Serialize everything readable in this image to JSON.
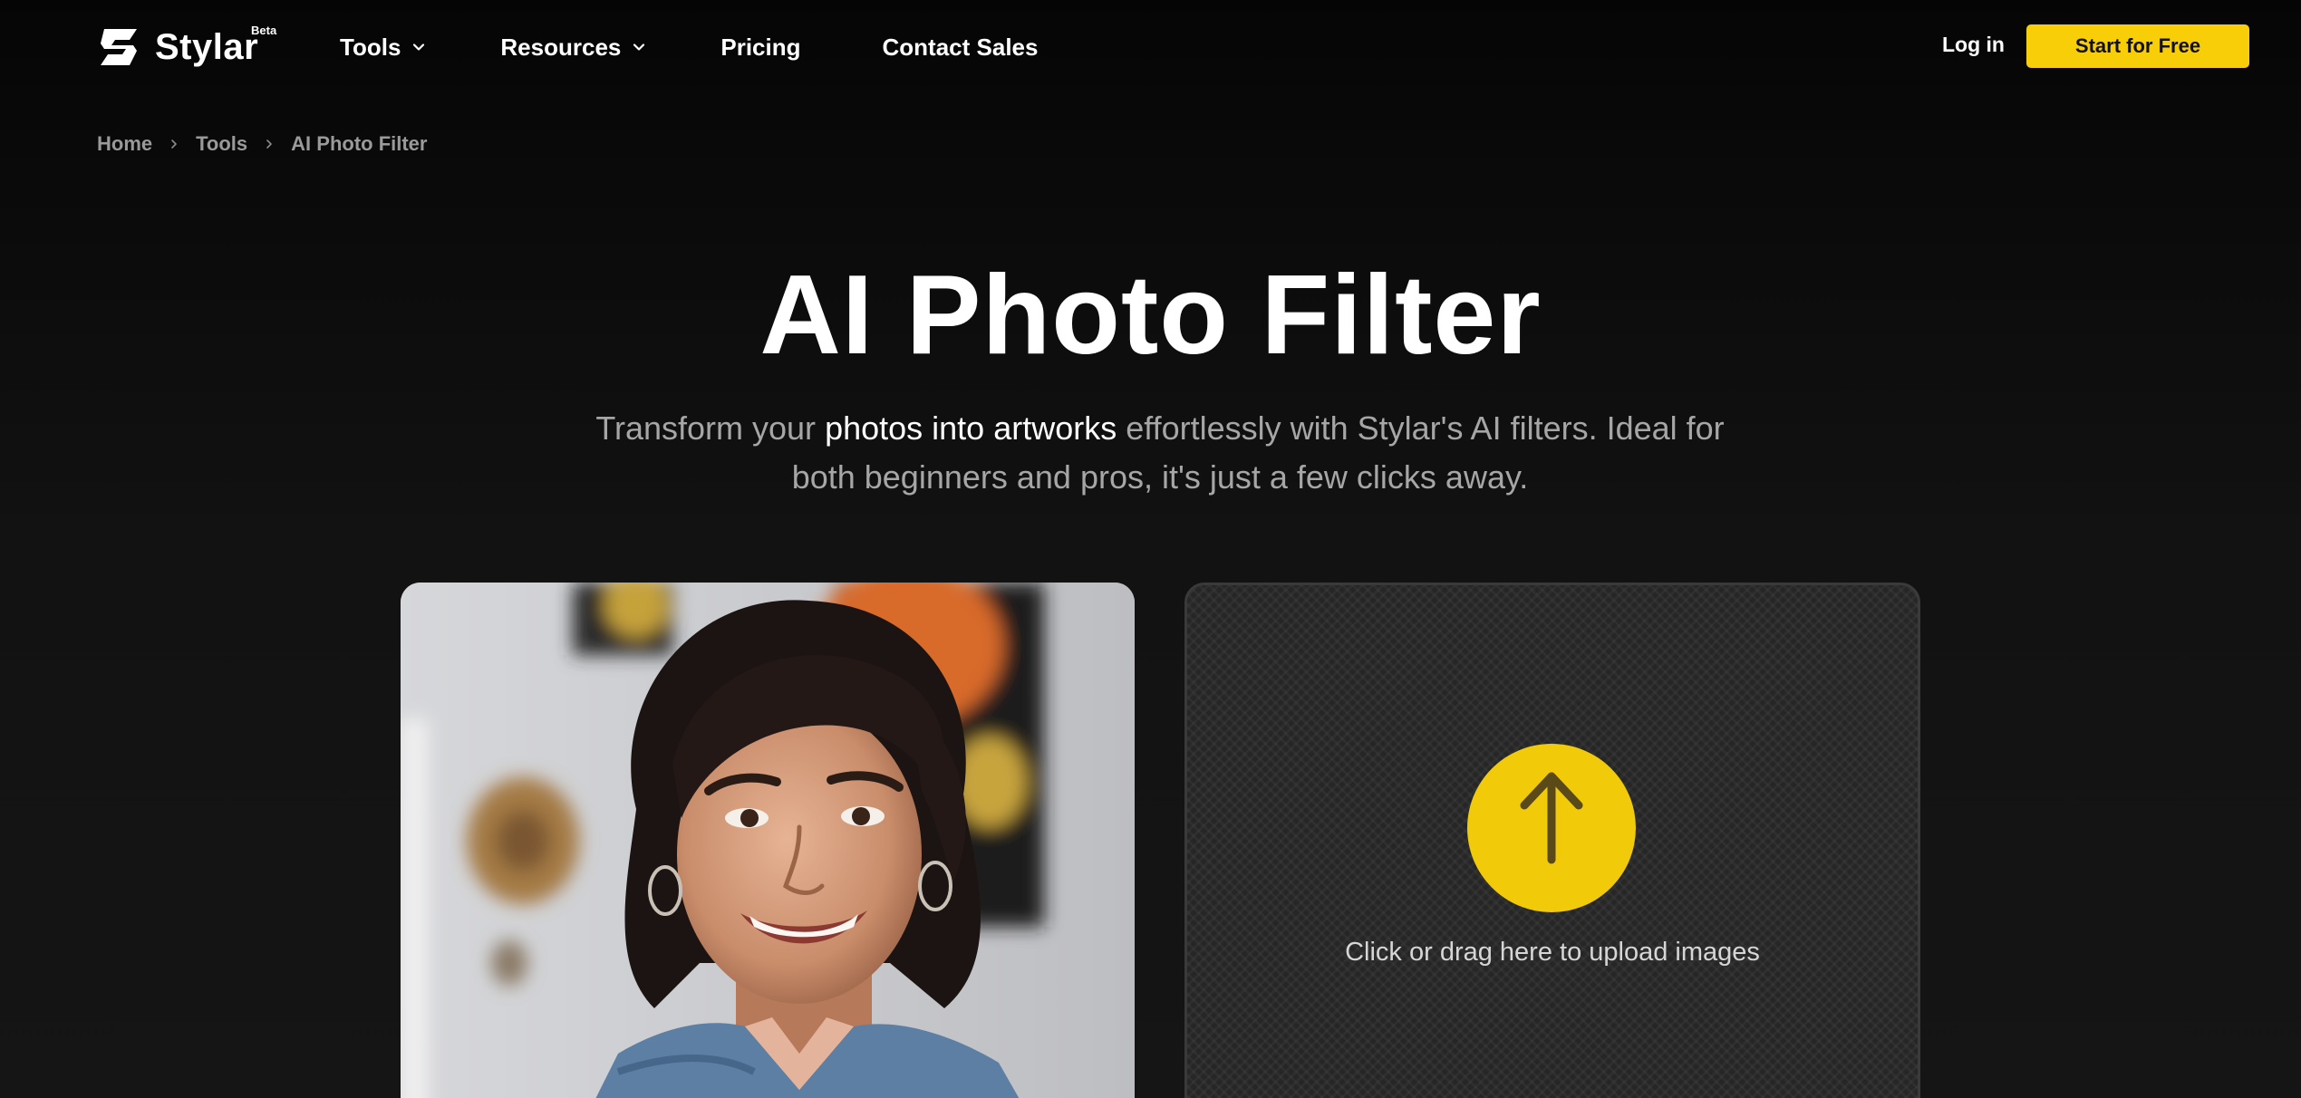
{
  "brand": {
    "name": "Stylar",
    "badge": "Beta"
  },
  "nav": {
    "items": [
      {
        "label": "Tools",
        "has_dropdown": true
      },
      {
        "label": "Resources",
        "has_dropdown": true
      },
      {
        "label": "Pricing",
        "has_dropdown": false
      },
      {
        "label": "Contact Sales",
        "has_dropdown": false
      }
    ],
    "login_label": "Log in",
    "cta_label": "Start for Free"
  },
  "breadcrumb": {
    "items": [
      "Home",
      "Tools",
      "AI Photo Filter"
    ]
  },
  "hero": {
    "title": "AI Photo Filter",
    "subtitle_pre": "Transform your ",
    "subtitle_highlight": "photos into artworks",
    "subtitle_post": " effortlessly with Stylar's AI filters. Ideal for both beginners and pros, it's just a few clicks away."
  },
  "upload": {
    "prompt": "Click or drag here to upload images",
    "icon": "arrow-up-icon"
  },
  "sample_photo": {
    "icon": "sample-portrait-image"
  },
  "colors": {
    "accent": "#f7ce08",
    "background": "#0a0a0a",
    "muted_text": "#a6a6a6"
  }
}
